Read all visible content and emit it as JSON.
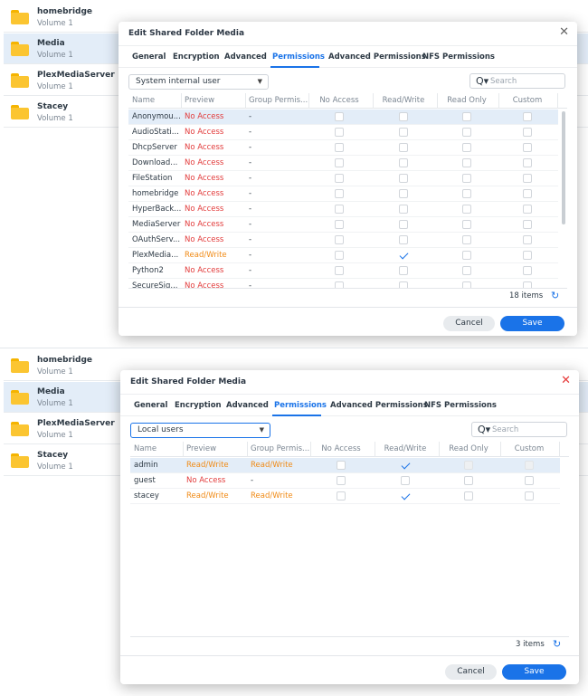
{
  "folders": [
    {
      "name": "homebridge",
      "volume": "Volume 1"
    },
    {
      "name": "Media",
      "volume": "Volume 1"
    },
    {
      "name": "PlexMediaServer",
      "volume": "Volume 1"
    },
    {
      "name": "Stacey",
      "volume": "Volume 1"
    }
  ],
  "dialog": {
    "title": "Edit Shared Folder Media",
    "close_icon": "close-icon",
    "tabs": [
      "General",
      "Encryption",
      "Advanced",
      "Permissions",
      "Advanced Permissions",
      "NFS Permissions"
    ],
    "active_tab": "Permissions",
    "search_placeholder": "Search",
    "columns": [
      "Name",
      "Preview",
      "Group Permis...",
      "No Access",
      "Read/Write",
      "Read Only",
      "Custom"
    ],
    "cancel_label": "Cancel",
    "save_label": "Save"
  },
  "panel1": {
    "user_type": "System internal user",
    "items_count": "18 items",
    "rows": [
      {
        "name": "Anonymou...",
        "preview": "No Access",
        "group": "-",
        "checked": "",
        "selected": true
      },
      {
        "name": "AudioStati...",
        "preview": "No Access",
        "group": "-",
        "checked": ""
      },
      {
        "name": "DhcpServer",
        "preview": "No Access",
        "group": "-",
        "checked": ""
      },
      {
        "name": "Download...",
        "preview": "No Access",
        "group": "-",
        "checked": ""
      },
      {
        "name": "FileStation",
        "preview": "No Access",
        "group": "-",
        "checked": ""
      },
      {
        "name": "homebridge",
        "preview": "No Access",
        "group": "-",
        "checked": ""
      },
      {
        "name": "HyperBack...",
        "preview": "No Access",
        "group": "-",
        "checked": ""
      },
      {
        "name": "MediaServer",
        "preview": "No Access",
        "group": "-",
        "checked": ""
      },
      {
        "name": "OAuthServ...",
        "preview": "No Access",
        "group": "-",
        "checked": ""
      },
      {
        "name": "PlexMedia...",
        "preview": "Read/Write",
        "group": "-",
        "checked": "rw"
      },
      {
        "name": "Python2",
        "preview": "No Access",
        "group": "-",
        "checked": ""
      },
      {
        "name": "SecureSig...",
        "preview": "No Access",
        "group": "-",
        "checked": ""
      }
    ]
  },
  "panel2": {
    "user_type": "Local users",
    "items_count": "3 items",
    "rows": [
      {
        "name": "admin",
        "preview": "Read/Write",
        "group": "Read/Write",
        "checked": "rw",
        "selected": true,
        "disabled": true
      },
      {
        "name": "guest",
        "preview": "No Access",
        "group": "-",
        "checked": ""
      },
      {
        "name": "stacey",
        "preview": "Read/Write",
        "group": "Read/Write",
        "checked": "rw"
      }
    ]
  },
  "colors": {
    "accent": "#1a73e8",
    "no_access": "#e23b3b",
    "read_write": "#f08a15",
    "folder": "#fbc531"
  }
}
